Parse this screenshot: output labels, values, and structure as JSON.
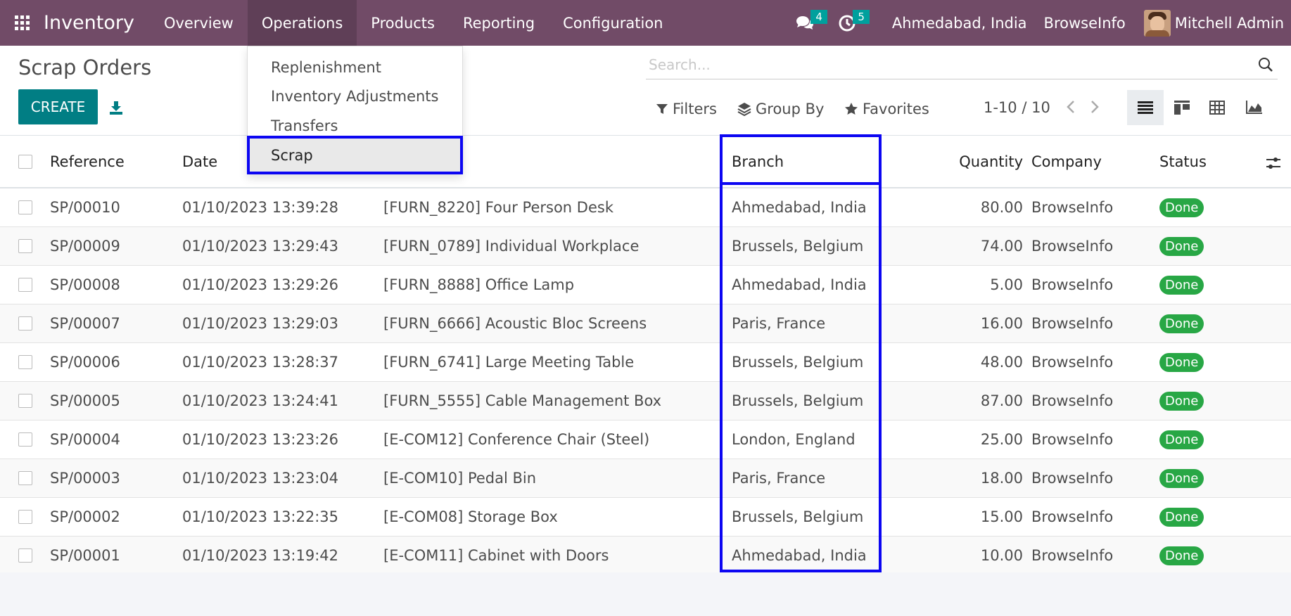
{
  "navbar": {
    "app_name": "Inventory",
    "menu": [
      "Overview",
      "Operations",
      "Products",
      "Reporting",
      "Configuration"
    ],
    "active_menu": "Operations",
    "messages_count": "4",
    "activities_count": "5",
    "branch": "Ahmedabad, India",
    "company": "BrowseInfo",
    "user": "Mitchell Admin",
    "bg_color": "#714b67"
  },
  "operations_menu": {
    "items": [
      "Replenishment",
      "Inventory Adjustments",
      "Transfers",
      "Scrap"
    ],
    "selected": "Scrap"
  },
  "control_panel": {
    "title": "Scrap Orders",
    "create_label": "CREATE",
    "search_placeholder": "Search...",
    "filters_label": "Filters",
    "groupby_label": "Group By",
    "favorites_label": "Favorites",
    "pager": "1-10 / 10",
    "views": [
      "list-view",
      "kanban-view",
      "pivot-view",
      "graph-view"
    ],
    "active_view": "list-view"
  },
  "table": {
    "headers": {
      "reference": "Reference",
      "date": "Date",
      "branch": "Branch",
      "quantity": "Quantity",
      "company": "Company",
      "status": "Status"
    },
    "rows": [
      {
        "ref": "SP/00010",
        "date": "01/10/2023 13:39:28",
        "product": "[FURN_8220] Four Person Desk",
        "branch": "Ahmedabad, India",
        "qty": "80.00",
        "company": "BrowseInfo",
        "status": "Done"
      },
      {
        "ref": "SP/00009",
        "date": "01/10/2023 13:29:43",
        "product": "[FURN_0789] Individual Workplace",
        "branch": "Brussels, Belgium",
        "qty": "74.00",
        "company": "BrowseInfo",
        "status": "Done"
      },
      {
        "ref": "SP/00008",
        "date": "01/10/2023 13:29:26",
        "product": "[FURN_8888] Office Lamp",
        "branch": "Ahmedabad, India",
        "qty": "5.00",
        "company": "BrowseInfo",
        "status": "Done"
      },
      {
        "ref": "SP/00007",
        "date": "01/10/2023 13:29:03",
        "product": "[FURN_6666] Acoustic Bloc Screens",
        "branch": "Paris, France",
        "qty": "16.00",
        "company": "BrowseInfo",
        "status": "Done"
      },
      {
        "ref": "SP/00006",
        "date": "01/10/2023 13:28:37",
        "product": "[FURN_6741] Large Meeting Table",
        "branch": "Brussels, Belgium",
        "qty": "48.00",
        "company": "BrowseInfo",
        "status": "Done"
      },
      {
        "ref": "SP/00005",
        "date": "01/10/2023 13:24:41",
        "product": "[FURN_5555] Cable Management Box",
        "branch": "Brussels, Belgium",
        "qty": "87.00",
        "company": "BrowseInfo",
        "status": "Done"
      },
      {
        "ref": "SP/00004",
        "date": "01/10/2023 13:23:26",
        "product": "[E-COM12] Conference Chair (Steel)",
        "branch": "London, England",
        "qty": "25.00",
        "company": "BrowseInfo",
        "status": "Done"
      },
      {
        "ref": "SP/00003",
        "date": "01/10/2023 13:23:04",
        "product": "[E-COM10] Pedal Bin",
        "branch": "Paris, France",
        "qty": "18.00",
        "company": "BrowseInfo",
        "status": "Done"
      },
      {
        "ref": "SP/00002",
        "date": "01/10/2023 13:22:35",
        "product": "[E-COM08] Storage Box",
        "branch": "Brussels, Belgium",
        "qty": "15.00",
        "company": "BrowseInfo",
        "status": "Done"
      },
      {
        "ref": "SP/00001",
        "date": "01/10/2023 13:19:42",
        "product": "[E-COM11] Cabinet with Doors",
        "branch": "Ahmedabad, India",
        "qty": "10.00",
        "company": "BrowseInfo",
        "status": "Done"
      }
    ]
  },
  "colors": {
    "primary": "#017e84",
    "status_done": "#28a745",
    "highlight": "#0c06f2"
  }
}
